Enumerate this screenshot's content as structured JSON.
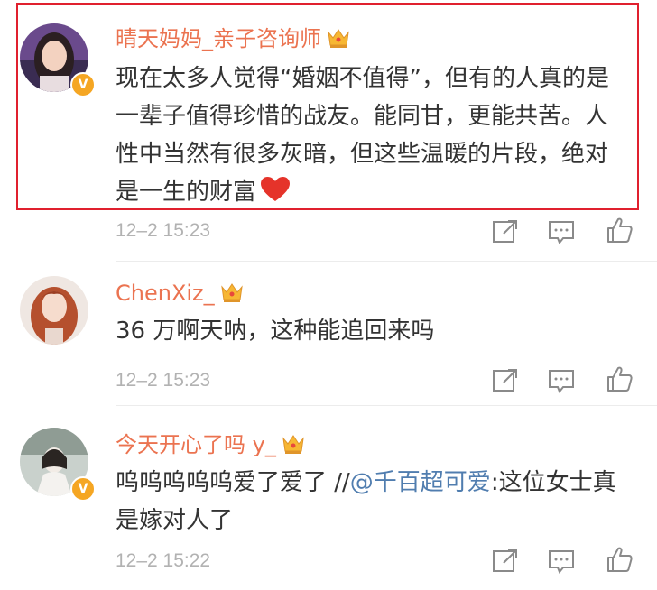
{
  "comments": [
    {
      "username": "晴天妈妈_亲子咨询师",
      "text": "现在太多人觉得“婚姻不值得”，但有的人真的是一辈子值得珍惜的战友。能同甘，更能共苦。人性中当然有很多灰暗，但这些温暖的片段，绝对是一生的财富",
      "trailing_icon": "red-heart-icon",
      "time": "12–2 15:23",
      "verified_badge": "V"
    },
    {
      "username": "ChenXiz_",
      "text": "36 万啊天呐，这种能追回来吗",
      "time": "12–2 15:23"
    },
    {
      "username": "今天开心了吗 y_",
      "text_before": "呜呜呜呜呜爱了爱了 //",
      "mention": "@千百超可爱",
      "text_after": ":这位女士真是嫁对人了",
      "time": "12–2 15:22",
      "verified_badge": "V"
    }
  ],
  "actions": [
    "share-icon",
    "comment-icon",
    "like-icon"
  ],
  "colors": {
    "username": "#eb7350",
    "text": "#333333",
    "mention": "#507daf",
    "time": "#b2b2b2",
    "highlight_border": "#e0202e",
    "badge": "#f5a623"
  }
}
